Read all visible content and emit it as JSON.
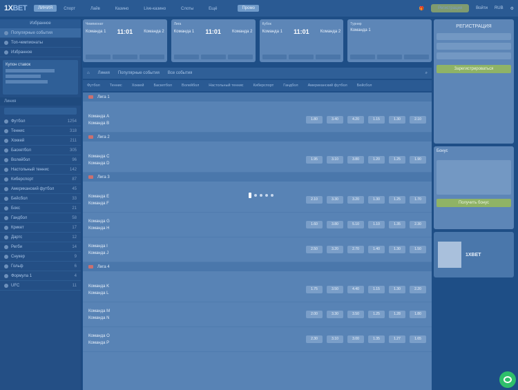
{
  "topbar": {
    "logo_main": "1X",
    "logo_suffix": "BET",
    "user_label": "ЛИНИЯ",
    "nav": [
      "Спорт",
      "Лайв",
      "Казино",
      "Live-казино",
      "Слоты",
      "Ещё"
    ],
    "active_tab": "Промо",
    "promo_button": "Регистрация",
    "right_items": [
      "Войти",
      "RUB"
    ]
  },
  "left": {
    "header": "Избранное",
    "items": [
      {
        "label": "Популярные события",
        "count": ""
      },
      {
        "label": "Топ-чемпионаты",
        "count": ""
      },
      {
        "label": "Избранное",
        "count": ""
      }
    ],
    "betslip_title": "Купон ставок",
    "section": "Линия",
    "filter_label": "Фильтр",
    "sports": [
      {
        "label": "Футбол",
        "count": "1254"
      },
      {
        "label": "Теннис",
        "count": "318"
      },
      {
        "label": "Хоккей",
        "count": "211"
      },
      {
        "label": "Баскетбол",
        "count": "305"
      },
      {
        "label": "Волейбол",
        "count": "96"
      },
      {
        "label": "Настольный теннис",
        "count": "142"
      },
      {
        "label": "Киберспорт",
        "count": "87"
      },
      {
        "label": "Американский футбол",
        "count": "45"
      },
      {
        "label": "Бейсбол",
        "count": "33"
      },
      {
        "label": "Бокс",
        "count": "21"
      },
      {
        "label": "Гандбол",
        "count": "58"
      },
      {
        "label": "Крикет",
        "count": "17"
      },
      {
        "label": "Дартс",
        "count": "12"
      },
      {
        "label": "Регби",
        "count": "14"
      },
      {
        "label": "Снукер",
        "count": "9"
      },
      {
        "label": "Гольф",
        "count": "6"
      },
      {
        "label": "Формула 1",
        "count": "4"
      },
      {
        "label": "UFC",
        "count": "11"
      }
    ]
  },
  "carousel": [
    {
      "league": "Чемпионат",
      "team1": "Команда 1",
      "score": "11:01",
      "team2": "Команда 2"
    },
    {
      "league": "Лига",
      "team1": "Команда 1",
      "score": "11:01",
      "team2": "Команда 2"
    },
    {
      "league": "Кубок",
      "team1": "Команда 1",
      "score": "11:01",
      "team2": "Команда 2"
    },
    {
      "league": "Турнир",
      "team1": "Команда 1",
      "score": "",
      "team2": ""
    }
  ],
  "main": {
    "breadcrumb": [
      "Линия",
      "Популярные события",
      "Все события"
    ],
    "tabs": [
      "Футбол",
      "Теннис",
      "Хоккей",
      "Баскетбол",
      "Волейбол",
      "Настольный теннис",
      "Киберспорт",
      "Гандбол",
      "Американский футбол",
      "Бейсбол"
    ],
    "leagues": [
      {
        "name": "Лига 1",
        "events": [
          {
            "t1": "Команда A",
            "t2": "Команда B",
            "odds": [
              "1.80",
              "3.40",
              "4.20",
              "1.15",
              "1.30",
              "2.10"
            ]
          }
        ]
      },
      {
        "name": "Лига 2",
        "events": [
          {
            "t1": "Команда C",
            "t2": "Команда D",
            "odds": [
              "1.95",
              "3.10",
              "3.80",
              "1.20",
              "1.25",
              "1.90"
            ]
          }
        ]
      },
      {
        "name": "Лига 3",
        "events": [
          {
            "t1": "Команда E",
            "t2": "Команда F",
            "odds": [
              "2.10",
              "3.30",
              "3.20",
              "1.30",
              "1.25",
              "1.70"
            ]
          },
          {
            "t1": "Команда G",
            "t2": "Команда H",
            "odds": [
              "1.60",
              "3.80",
              "5.10",
              "1.10",
              "1.35",
              "2.30"
            ]
          },
          {
            "t1": "Команда I",
            "t2": "Команда J",
            "odds": [
              "2.50",
              "3.20",
              "2.70",
              "1.40",
              "1.30",
              "1.50"
            ]
          }
        ]
      },
      {
        "name": "Лига 4",
        "events": [
          {
            "t1": "Команда K",
            "t2": "Команда L",
            "odds": [
              "1.75",
              "3.50",
              "4.40",
              "1.15",
              "1.30",
              "2.20"
            ]
          },
          {
            "t1": "Команда M",
            "t2": "Команда N",
            "odds": [
              "2.00",
              "3.30",
              "3.50",
              "1.25",
              "1.28",
              "1.80"
            ]
          },
          {
            "t1": "Команда O",
            "t2": "Команда P",
            "odds": [
              "2.30",
              "3.10",
              "3.00",
              "1.35",
              "1.27",
              "1.65"
            ]
          }
        ]
      }
    ]
  },
  "right": {
    "reg_title": "РЕГИСТРАЦИЯ",
    "reg_button": "Зарегистрироваться",
    "promo_title": "Бонус",
    "promo_button": "Получить бонус",
    "app_title": "1XBET"
  },
  "loader": {
    "dots": 5
  }
}
